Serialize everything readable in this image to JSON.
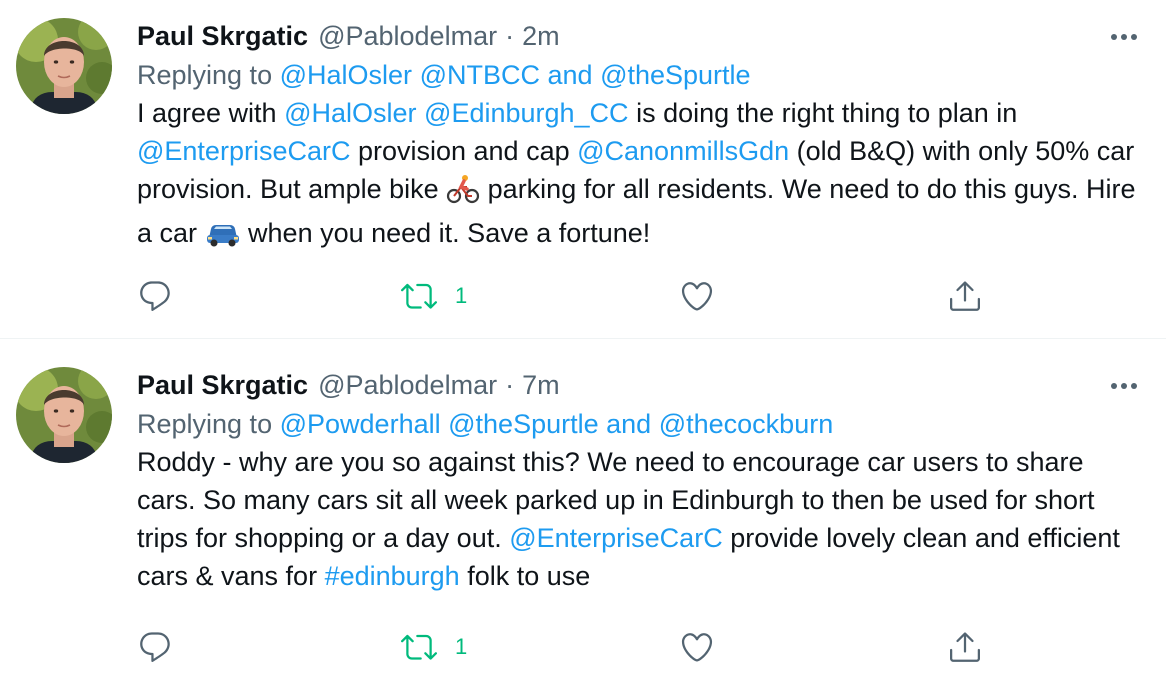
{
  "tweets": [
    {
      "author_name": "Paul Skrgatic",
      "handle": "@Pablodelmar",
      "separator": "·",
      "time": "2m",
      "replying_prefix": "Replying to",
      "replying_handles": [
        "@HalOsler",
        "@NTBCC"
      ],
      "replying_and": "and",
      "replying_last": "@theSpurtle",
      "text_segments": [
        {
          "type": "text",
          "value": "I agree with "
        },
        {
          "type": "mention",
          "value": "@HalOsler"
        },
        {
          "type": "text",
          "value": " "
        },
        {
          "type": "mention",
          "value": "@Edinburgh_CC"
        },
        {
          "type": "text",
          "value": " is doing the right thing to plan in "
        },
        {
          "type": "mention",
          "value": "@EnterpriseCarC"
        },
        {
          "type": "text",
          "value": " provision and cap "
        },
        {
          "type": "mention",
          "value": "@CanonmillsGdn"
        },
        {
          "type": "text",
          "value": " (old B&Q) with only 50% car provision. But ample bike "
        },
        {
          "type": "emoji",
          "value": "person-biking-emoji"
        },
        {
          "type": "text",
          "value": " parking for all residents. We need to do this guys. Hire a car "
        },
        {
          "type": "emoji",
          "value": "automobile-emoji"
        },
        {
          "type": "text",
          "value": " when you need it. Save a fortune!"
        }
      ],
      "actions": {
        "reply_icon": "reply-icon",
        "retweet_icon": "retweet-icon",
        "retweet_count": "1",
        "like_icon": "heart-icon",
        "share_icon": "share-icon"
      }
    },
    {
      "author_name": "Paul Skrgatic",
      "handle": "@Pablodelmar",
      "separator": "·",
      "time": "7m",
      "replying_prefix": "Replying to",
      "replying_handles": [
        "@Powderhall",
        "@theSpurtle"
      ],
      "replying_and": "and",
      "replying_last": "@thecockburn",
      "text_segments": [
        {
          "type": "text",
          "value": "Roddy - why are you so against this? We need to encourage car users to share cars. So many cars sit all week parked up in Edinburgh to then be used for short trips for shopping or a day out. "
        },
        {
          "type": "mention",
          "value": "@EnterpriseCarC"
        },
        {
          "type": "text",
          "value": " provide lovely clean and efficient cars & vans for "
        },
        {
          "type": "hashtag",
          "value": "#edinburgh"
        },
        {
          "type": "text",
          "value": " folk to use"
        }
      ],
      "actions": {
        "reply_icon": "reply-icon",
        "retweet_icon": "retweet-icon",
        "retweet_count": "1",
        "like_icon": "heart-icon",
        "share_icon": "share-icon"
      }
    }
  ],
  "colors": {
    "text": "#0f1419",
    "secondary": "#536471",
    "link": "#1d9bf0",
    "retweet_green": "#00ba7c",
    "divider": "#eff3f4"
  }
}
